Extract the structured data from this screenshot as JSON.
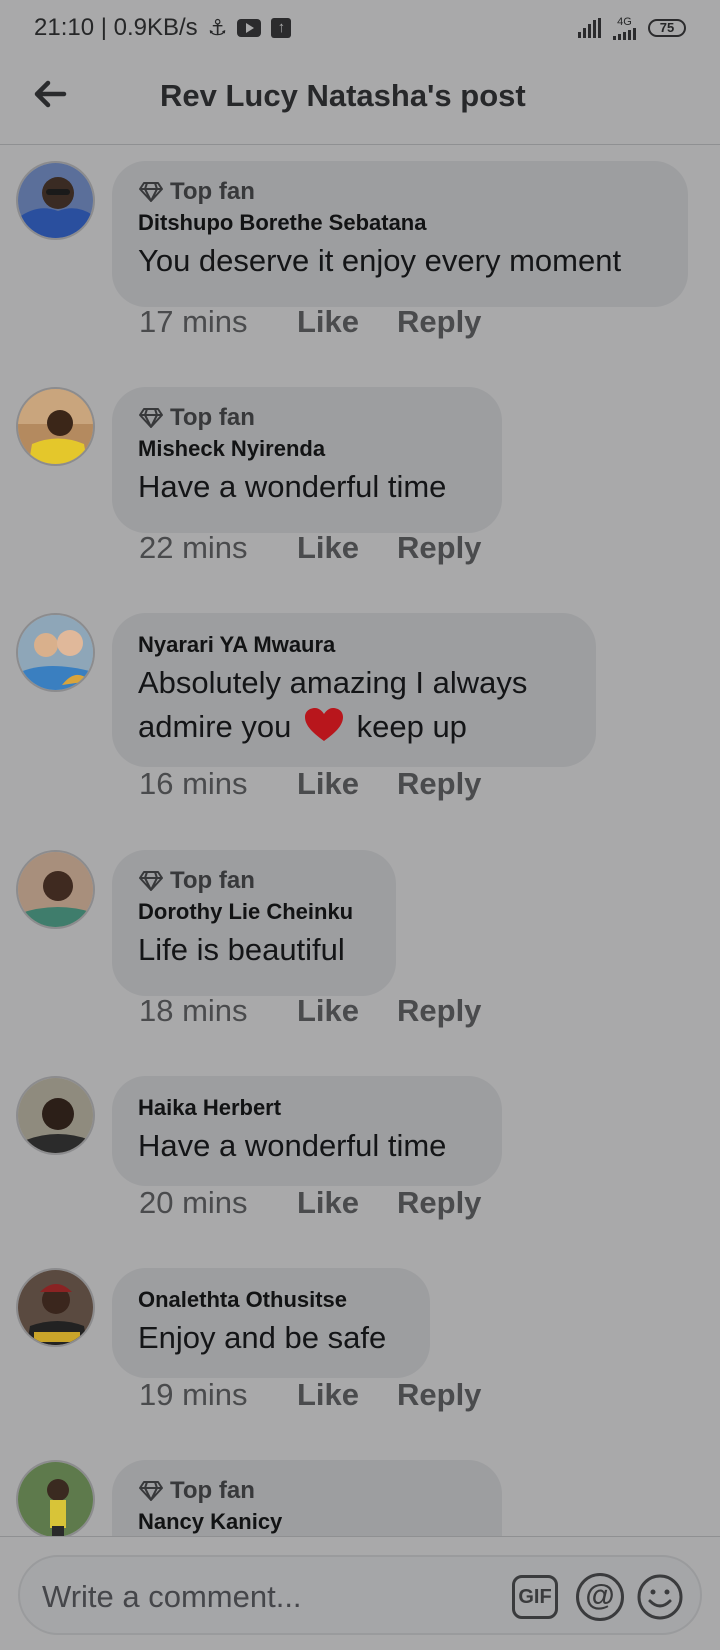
{
  "status_bar": {
    "time_speed": "21:10 | 0.9KB/s",
    "network": "4G",
    "battery": "75"
  },
  "header": {
    "title": "Rev Lucy Natasha's post"
  },
  "comments": [
    {
      "badge": "Top fan",
      "author": "Ditshupo Borethe Sebatana",
      "text": "You deserve it enjoy every moment",
      "time": "17 mins",
      "like": "Like",
      "reply": "Reply"
    },
    {
      "badge": "Top fan",
      "author": "Misheck Nyirenda",
      "text": "Have a wonderful time",
      "time": "22 mins",
      "like": "Like",
      "reply": "Reply"
    },
    {
      "author": "Nyarari YA Mwaura",
      "text_line1": "Absolutely amazing I always",
      "text_line2a": "admire you",
      "emoji": "❤️",
      "text_line2b": "keep up",
      "time": "16 mins",
      "like": "Like",
      "reply": "Reply"
    },
    {
      "badge": "Top fan",
      "author": "Dorothy Lie Cheinku",
      "text": "Life is beautiful",
      "time": "18 mins",
      "like": "Like",
      "reply": "Reply"
    },
    {
      "author": "Haika Herbert",
      "text": "Have a wonderful time",
      "time": "20 mins",
      "like": "Like",
      "reply": "Reply"
    },
    {
      "author": "Onalethta Othusitse",
      "text": "Enjoy and be safe",
      "time": "19 mins",
      "like": "Like",
      "reply": "Reply"
    },
    {
      "badge": "Top fan",
      "author": "Nancy Kanicy"
    }
  ],
  "composer": {
    "placeholder": "Write a comment...",
    "gif_label": "GIF",
    "mention_label": "@"
  }
}
